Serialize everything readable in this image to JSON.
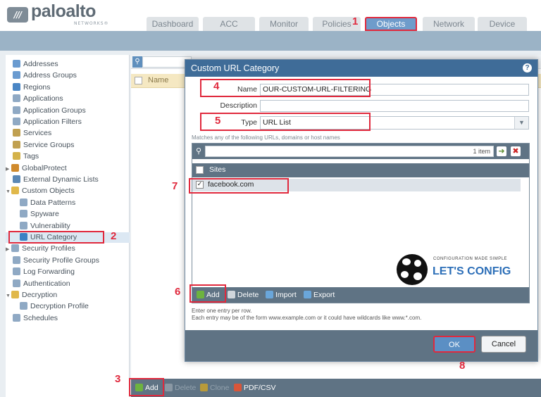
{
  "logo": {
    "word": "paloalto",
    "sub": "NETWORKS®"
  },
  "tabs": [
    {
      "label": "Dashboard"
    },
    {
      "label": "ACC"
    },
    {
      "label": "Monitor"
    },
    {
      "label": "Policies"
    },
    {
      "label": "Objects"
    },
    {
      "label": "Network"
    },
    {
      "label": "Device"
    }
  ],
  "active_tab": "Objects",
  "sidebar": {
    "items": [
      {
        "label": "Addresses",
        "icon": "addresses-icon",
        "color": "#6a9bd0"
      },
      {
        "label": "Address Groups",
        "icon": "address-groups-icon",
        "color": "#6a9bd0"
      },
      {
        "label": "Regions",
        "icon": "globe-icon",
        "color": "#4a86c5"
      },
      {
        "label": "Applications",
        "icon": "applications-icon",
        "color": "#8fa9c4"
      },
      {
        "label": "Application Groups",
        "icon": "application-groups-icon",
        "color": "#8fa9c4"
      },
      {
        "label": "Application Filters",
        "icon": "filter-icon",
        "color": "#8fa9c4"
      },
      {
        "label": "Services",
        "icon": "services-icon",
        "color": "#c0a050"
      },
      {
        "label": "Service Groups",
        "icon": "service-groups-icon",
        "color": "#c0a050"
      },
      {
        "label": "Tags",
        "icon": "tag-icon",
        "color": "#d4b24a"
      },
      {
        "label": "GlobalProtect",
        "icon": "globalprotect-icon",
        "color": "#d08a2c"
      },
      {
        "label": "External Dynamic Lists",
        "icon": "list-icon",
        "color": "#5b88b5"
      },
      {
        "label": "Custom Objects",
        "icon": "folder-icon",
        "color": "#e0b84a"
      },
      {
        "label": "Data Patterns",
        "icon": "data-patterns-icon",
        "color": "#8fa9c4"
      },
      {
        "label": "Spyware",
        "icon": "spyware-icon",
        "color": "#8fa9c4"
      },
      {
        "label": "Vulnerability",
        "icon": "vulnerability-icon",
        "color": "#8fa9c4"
      },
      {
        "label": "URL Category",
        "icon": "url-category-icon",
        "color": "#3b82c4"
      },
      {
        "label": "Security Profiles",
        "icon": "security-profiles-icon",
        "color": "#8fa9c4"
      },
      {
        "label": "Security Profile Groups",
        "icon": "security-profile-groups-icon",
        "color": "#8fa9c4"
      },
      {
        "label": "Log Forwarding",
        "icon": "log-forwarding-icon",
        "color": "#8fa9c4"
      },
      {
        "label": "Authentication",
        "icon": "authentication-icon",
        "color": "#8fa9c4"
      },
      {
        "label": "Decryption",
        "icon": "lock-icon",
        "color": "#e0b84a"
      },
      {
        "label": "Decryption Profile",
        "icon": "decryption-profile-icon",
        "color": "#8fa9c4"
      },
      {
        "label": "Schedules",
        "icon": "schedule-icon",
        "color": "#8fa9c4"
      }
    ]
  },
  "main": {
    "column_name": "Name"
  },
  "toolbar": {
    "add": "Add",
    "delete": "Delete",
    "clone": "Clone",
    "pdf": "PDF/CSV"
  },
  "modal": {
    "title": "Custom URL Category",
    "help": "?",
    "name_label": "Name",
    "name_value": "OUR-CUSTOM-URL-FILTERING",
    "description_label": "Description",
    "description_value": "",
    "type_label": "Type",
    "type_value": "URL List",
    "hint": "Matches any of the following URLs, domains or host names",
    "items_count": "1 item",
    "sites_header": "Sites",
    "sites": [
      "facebook.com"
    ],
    "sites_toolbar": {
      "add": "Add",
      "delete": "Delete",
      "import": "Import",
      "export": "Export"
    },
    "footer_line1": "Enter one entry per row.",
    "footer_line2": "Each entry may be of the form www.example.com or it could have wildcards like www.*.com.",
    "ok": "OK",
    "cancel": "Cancel"
  },
  "watermark": {
    "tagline": "CONFIGURATION MADE SIMPLE",
    "brand": "LET'S CONFIG"
  },
  "annotations": [
    "1",
    "2",
    "3",
    "4",
    "5",
    "6",
    "7",
    "8"
  ],
  "colors": {
    "accent": "#3f6c98",
    "highlight": "#e0293d",
    "toolbar": "#5f7384"
  }
}
